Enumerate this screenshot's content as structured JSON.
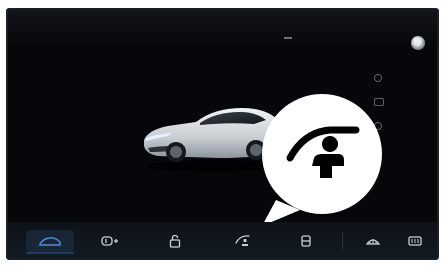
{
  "screen": {
    "bottom_nav": {
      "items": [
        {
          "name": "vehicle-overview-tab",
          "icon": "car-silhouette-icon",
          "active": true
        },
        {
          "name": "lights-tab",
          "icon": "headlight-icon",
          "active": false
        },
        {
          "name": "locks-tab",
          "icon": "lock-icon",
          "active": false
        },
        {
          "name": "driver-assist-tab",
          "icon": "driver-seat-icon",
          "active": false
        },
        {
          "name": "seat-tab",
          "icon": "seat-icon",
          "active": false
        },
        {
          "name": "front-defrost-button",
          "icon": "front-defrost-icon",
          "active": false
        },
        {
          "name": "rear-defrost-button",
          "icon": "rear-defrost-icon",
          "active": false
        }
      ]
    },
    "callout": {
      "icon": "driver-seat-icon"
    },
    "car_image": {
      "icon": "sedan-image"
    },
    "colors": {
      "background": "#05070a",
      "accent": "#4f8ed6",
      "icon": "#c9d0d8",
      "callout_fill": "#ffffff",
      "callout_icon": "#000000"
    }
  }
}
